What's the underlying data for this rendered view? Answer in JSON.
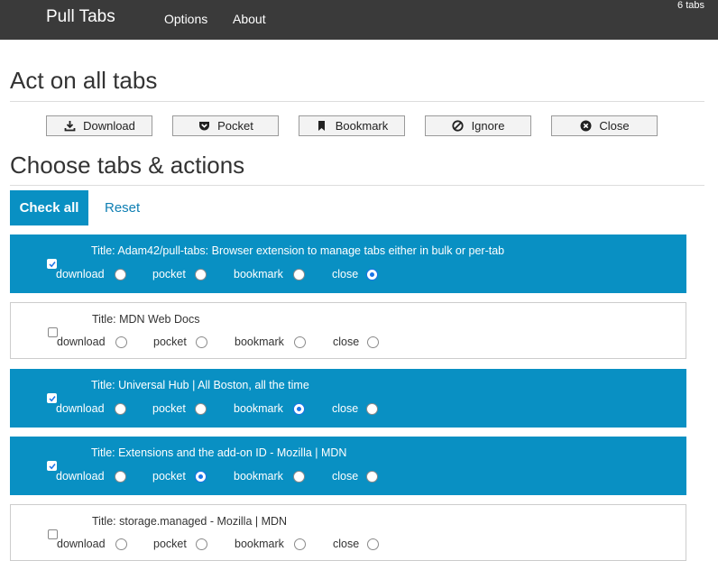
{
  "navbar": {
    "brand": "Pull Tabs",
    "links": [
      "Options",
      "About"
    ],
    "tab_count": "6 tabs"
  },
  "act_section": {
    "heading": "Act on all tabs",
    "buttons": [
      {
        "label": "Download",
        "icon": "download-icon"
      },
      {
        "label": "Pocket",
        "icon": "pocket-icon"
      },
      {
        "label": "Bookmark",
        "icon": "bookmark-icon"
      },
      {
        "label": "Ignore",
        "icon": "ignore-icon"
      },
      {
        "label": "Close",
        "icon": "close-circle-icon"
      }
    ]
  },
  "choose_section": {
    "heading": "Choose tabs & actions",
    "check_all_label": "Check all",
    "reset_label": "Reset"
  },
  "option_labels": [
    "download",
    "pocket",
    "bookmark",
    "close"
  ],
  "tabs": [
    {
      "title": "Title: Adam42/pull-tabs: Browser extension to manage tabs either in bulk or per-tab",
      "checked": true,
      "selected": "close"
    },
    {
      "title": "Title: MDN Web Docs",
      "checked": false,
      "selected": ""
    },
    {
      "title": "Title: Universal Hub | All Boston, all the time",
      "checked": true,
      "selected": "bookmark"
    },
    {
      "title": "Title: Extensions and the add-on ID - Mozilla | MDN",
      "checked": true,
      "selected": "pocket"
    },
    {
      "title": "Title: storage.managed - Mozilla | MDN",
      "checked": false,
      "selected": ""
    }
  ],
  "colors": {
    "navbar_bg": "#3a3a3a",
    "accent": "#0990c3",
    "link": "#0f7fb3",
    "radio_selected": "#1a73e8"
  }
}
